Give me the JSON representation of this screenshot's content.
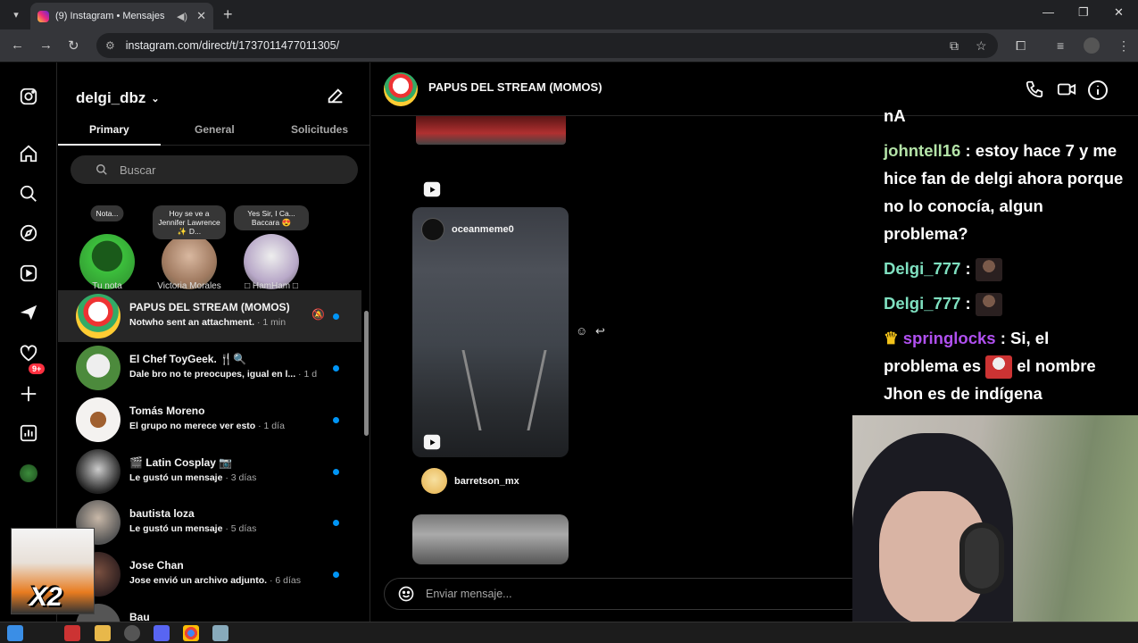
{
  "browser": {
    "tab_title": "(9) Instagram • Mensajes",
    "url": "instagram.com/direct/t/1737011477011305/"
  },
  "rail": {
    "notification_count": "9+"
  },
  "inbox": {
    "username": "delgi_dbz",
    "tabs": [
      "Primary",
      "General",
      "Solicitudes"
    ],
    "search_placeholder": "Buscar",
    "stories": [
      {
        "note": "Nota...",
        "name": "Tu nota"
      },
      {
        "note": "Hoy se ve a Jennifer Lawrence ✨ D...",
        "name": "Victoria Morales"
      },
      {
        "note": "Yes Sir, I Ca... Baccara 😍",
        "name": "□ HamHam □"
      }
    ],
    "conversations": [
      {
        "name": "PAPUS DEL STREAM (MOMOS)",
        "preview": "Notwho sent an attachment.",
        "time": "· 1 min",
        "muted": true
      },
      {
        "name": "El Chef ToyGeek. 🍴🔍",
        "preview": "Dale bro no te preocupes, igual en l...",
        "time": "· 1 día"
      },
      {
        "name": "Tomás Moreno",
        "preview": "El grupo no merece ver esto",
        "time": "· 1 día"
      },
      {
        "name": "🎬 Latin Cosplay 📷",
        "preview": "Le gustó un mensaje",
        "time": "· 3 días"
      },
      {
        "name": "bautista loza",
        "preview": "Le gustó un mensaje",
        "time": "· 5 días"
      },
      {
        "name": "Jose Chan",
        "preview": "Jose envió un archivo adjunto.",
        "time": "· 6 días"
      },
      {
        "name": "Bau",
        "preview": "",
        "time": ""
      }
    ]
  },
  "chat": {
    "group_name": "PAPUS DEL STREAM (MOMOS)",
    "reel_author": "oceanmeme0",
    "sender2": "barretson_mx",
    "composer_placeholder": "Enviar mensaje..."
  },
  "stream_chat": {
    "lines": [
      {
        "user": "",
        "text": "nA"
      },
      {
        "user": "johntell16",
        "text": ": estoy hace 7 y me hice fan de delgi ahora porque no lo conocía, algun problema?"
      },
      {
        "user": "Delgi_777",
        "text": ":"
      },
      {
        "user": "Delgi_777",
        "text": ":"
      },
      {
        "user": "springlocks",
        "text": ": Si, el problema es",
        "text2": "el nombre Jhon es de indígena"
      }
    ]
  },
  "overlay": {
    "goku_label": "X2"
  }
}
